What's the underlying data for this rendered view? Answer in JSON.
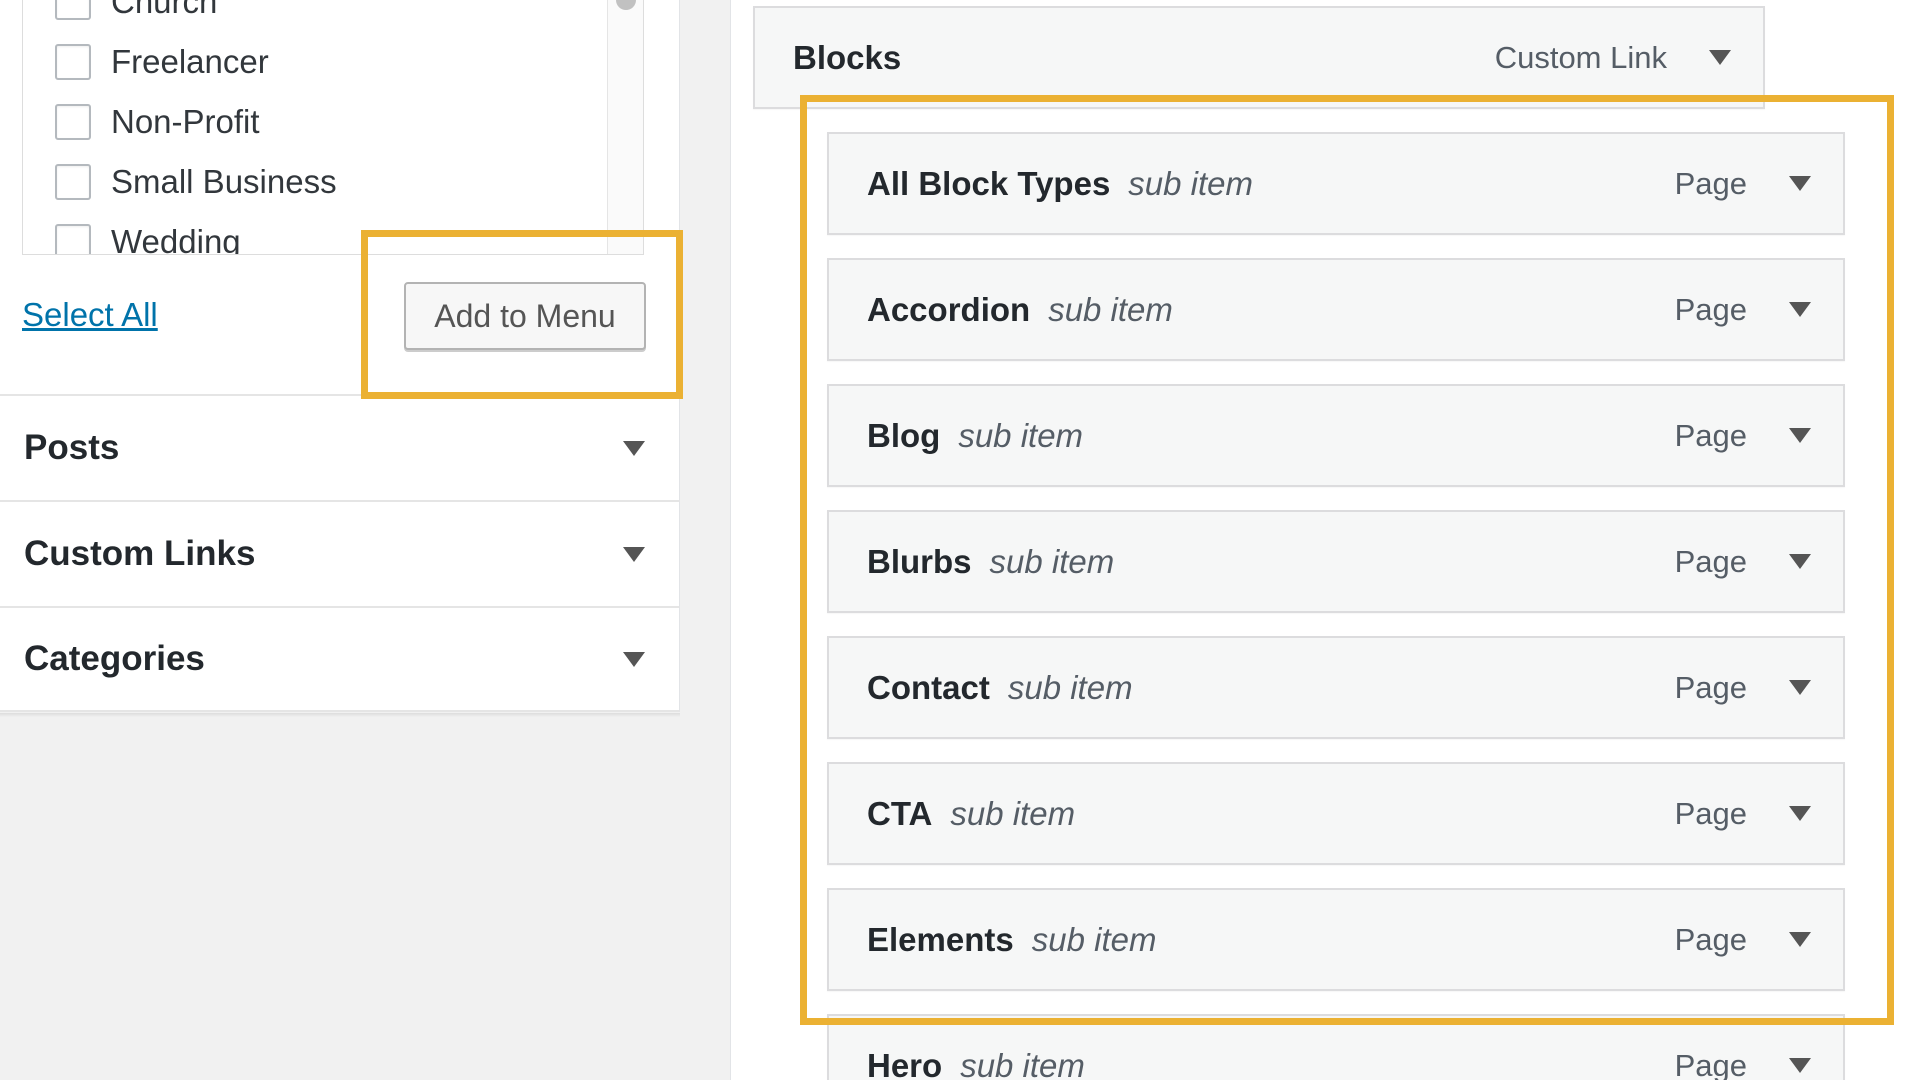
{
  "left_panel": {
    "checkbox_items": [
      "Church",
      "Freelancer",
      "Non-Profit",
      "Small Business",
      "Wedding"
    ],
    "select_all_label": "Select All",
    "add_to_menu_label": "Add to Menu",
    "sections": [
      {
        "title": "Posts"
      },
      {
        "title": "Custom Links"
      },
      {
        "title": "Categories"
      }
    ]
  },
  "menu_structure": {
    "parent_item": {
      "title": "Blocks",
      "type": "Custom Link"
    },
    "sub_items": [
      {
        "title": "All Block Types",
        "sub_label": "sub item",
        "type": "Page"
      },
      {
        "title": "Accordion",
        "sub_label": "sub item",
        "type": "Page"
      },
      {
        "title": "Blog",
        "sub_label": "sub item",
        "type": "Page"
      },
      {
        "title": "Blurbs",
        "sub_label": "sub item",
        "type": "Page"
      },
      {
        "title": "Contact",
        "sub_label": "sub item",
        "type": "Page"
      },
      {
        "title": "CTA",
        "sub_label": "sub item",
        "type": "Page"
      },
      {
        "title": "Elements",
        "sub_label": "sub item",
        "type": "Page"
      },
      {
        "title": "Hero",
        "sub_label": "sub item",
        "type": "Page"
      }
    ]
  },
  "icons": {
    "toggle": "triangle-down-icon",
    "checkbox": "checkbox-empty-icon"
  },
  "colors": {
    "highlight": "#ebb133",
    "link": "#0073aa"
  }
}
